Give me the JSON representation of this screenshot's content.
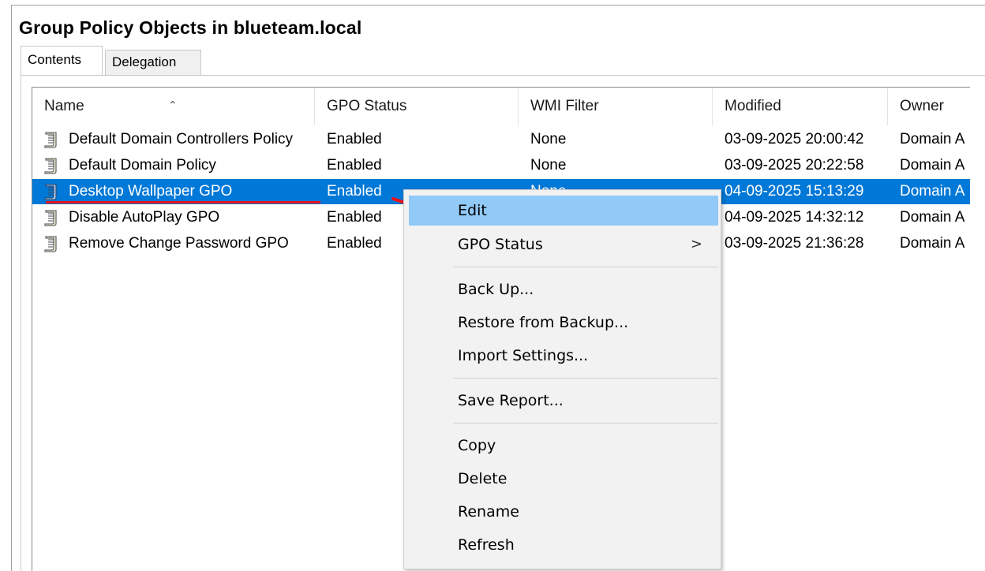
{
  "window": {
    "title": "Group Policy Objects in blueteam.local"
  },
  "tabs": [
    {
      "label": "Contents",
      "active": true
    },
    {
      "label": "Delegation",
      "active": false
    }
  ],
  "columns": {
    "name": "Name",
    "status": "GPO Status",
    "wmi": "WMI Filter",
    "modified": "Modified",
    "owner": "Owner",
    "sort_indicator": "^"
  },
  "rows": [
    {
      "name": "Default Domain Controllers Policy",
      "status": "Enabled",
      "wmi": "None",
      "modified": "03-09-2025 20:00:42",
      "owner": "Domain A",
      "selected": false
    },
    {
      "name": "Default Domain Policy",
      "status": "Enabled",
      "wmi": "None",
      "modified": "03-09-2025 20:22:58",
      "owner": "Domain A",
      "selected": false
    },
    {
      "name": "Desktop Wallpaper GPO",
      "status": "Enabled",
      "wmi": "None",
      "modified": "04-09-2025 15:13:29",
      "owner": "Domain A",
      "selected": true
    },
    {
      "name": "Disable AutoPlay GPO",
      "status": "Enabled",
      "wmi": "",
      "modified": "04-09-2025 14:32:12",
      "owner": "Domain A",
      "selected": false
    },
    {
      "name": "Remove Change Password GPO",
      "status": "Enabled",
      "wmi": "",
      "modified": "03-09-2025 21:36:28",
      "owner": "Domain A",
      "selected": false
    }
  ],
  "context_menu": {
    "edit": "Edit",
    "gpo_status": "GPO Status",
    "submenu_glyph": ">",
    "back_up": "Back Up...",
    "restore": "Restore from Backup...",
    "import": "Import Settings...",
    "save_report": "Save Report...",
    "copy": "Copy",
    "delete": "Delete",
    "rename": "Rename",
    "refresh": "Refresh"
  },
  "colors": {
    "selection": "#0078d7",
    "menu_hover": "#91c9f7",
    "annotation": "#e8141c"
  },
  "icons": {
    "row_icon": "gpo-scroll-icon",
    "annotation": "red-arrow-icon"
  }
}
